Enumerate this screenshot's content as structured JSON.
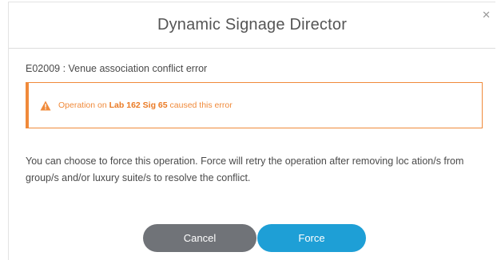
{
  "dialog": {
    "title": "Dynamic Signage Director",
    "close_icon": "close-icon",
    "error_code_line": "E02009 : Venue association conflict error",
    "alert": {
      "icon": "warning-triangle-icon",
      "prefix": "Operation on ",
      "target": "Lab 162 Sig 65",
      "suffix": " caused this error",
      "color": "#f08a3a"
    },
    "message": "You can choose to force this operation. Force will retry the operation after removing loc ation/s from group/s and/or luxury suite/s to resolve the conflict.",
    "buttons": {
      "cancel_label": "Cancel",
      "force_label": "Force"
    },
    "colors": {
      "cancel_bg": "#707378",
      "force_bg": "#1e9fd6"
    }
  }
}
